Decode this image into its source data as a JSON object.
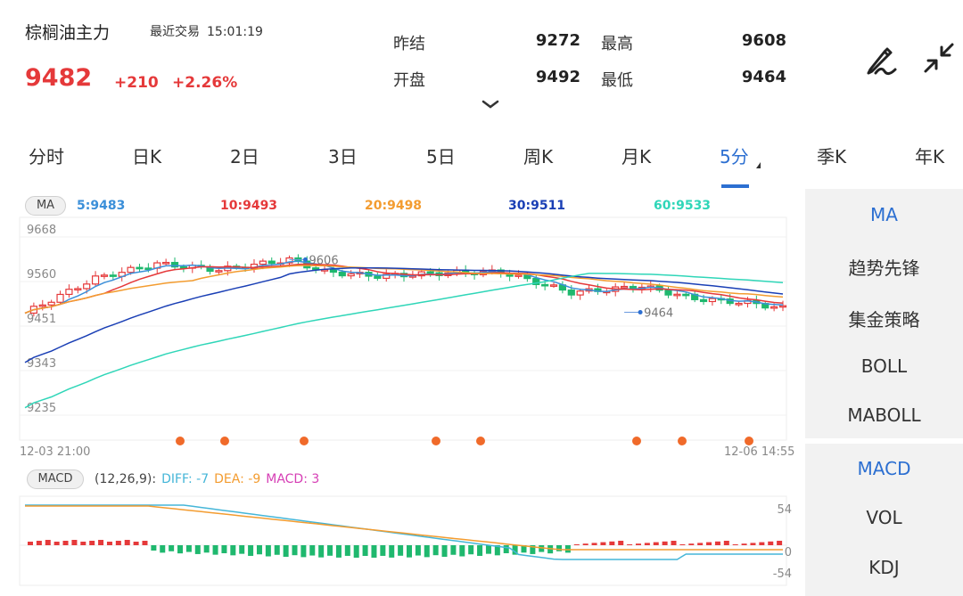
{
  "header": {
    "title": "棕榈油主力",
    "status_label": "最近交易",
    "time": "15:01:19",
    "price": "9482",
    "change": "+210",
    "change_pct": "+2.26%",
    "stats": [
      {
        "label": "昨结",
        "value": "9272"
      },
      {
        "label": "最高",
        "value": "9608"
      },
      {
        "label": "开盘",
        "value": "9492"
      },
      {
        "label": "最低",
        "value": "9464"
      }
    ]
  },
  "tabs": [
    {
      "label": "分时"
    },
    {
      "label": "日K"
    },
    {
      "label": "2日"
    },
    {
      "label": "3日"
    },
    {
      "label": "5日"
    },
    {
      "label": "周K"
    },
    {
      "label": "月K"
    },
    {
      "label": "5分",
      "active": true
    },
    {
      "label": "季K"
    },
    {
      "label": "年K"
    }
  ],
  "main_chart": {
    "indicator_button": "MA",
    "ma": [
      {
        "label": "5:9483",
        "color": "#3b8fd9"
      },
      {
        "label": "10:9493",
        "color": "#e5393a"
      },
      {
        "label": "20:9498",
        "color": "#f39c30"
      },
      {
        "label": "30:9511",
        "color": "#1a3fb5"
      },
      {
        "label": "60:9533",
        "color": "#2fd6b8"
      }
    ],
    "y_labels": [
      "9668",
      "9560",
      "9451",
      "9343",
      "9235"
    ],
    "high_label": "9606",
    "low_label": "9464",
    "start_time": "12-03 21:00",
    "end_time": "12-06 14:55"
  },
  "macd_chart": {
    "indicator_button": "MACD",
    "params": "(12,26,9):",
    "diff": "DIFF: -7",
    "dea": "DEA: -9",
    "macd": "MACD: 3",
    "y_labels": [
      "54",
      "0",
      "-54"
    ]
  },
  "side_panel": {
    "top": [
      {
        "label": "MA",
        "active": true
      },
      {
        "label": "趋势先锋"
      },
      {
        "label": "集金策略"
      },
      {
        "label": "BOLL"
      },
      {
        "label": "MABOLL"
      }
    ],
    "bottom": [
      {
        "label": "MACD",
        "active": true
      },
      {
        "label": "VOL"
      },
      {
        "label": "KDJ"
      }
    ]
  },
  "colors": {
    "up": "#e5393a",
    "down": "#1fb86e",
    "accent": "#2c6fd1",
    "diff": "#45b6d8",
    "dea": "#f39c30",
    "macd": "#d63fb5"
  }
}
